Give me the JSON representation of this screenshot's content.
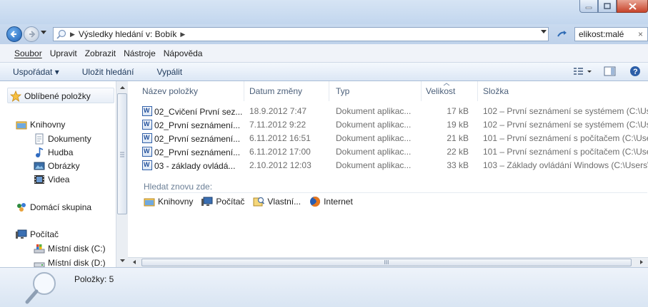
{
  "address": {
    "crumb_root": "Výsledky hledání v: Bobík"
  },
  "search": {
    "value": "elikost:malé",
    "clear": "×"
  },
  "menu": [
    "Soubor",
    "Upravit",
    "Zobrazit",
    "Nástroje",
    "Nápověda"
  ],
  "toolbar": {
    "organize": "Uspořádat ▾",
    "save_search": "Uložit hledání",
    "burn": "Vypálit"
  },
  "nav": {
    "favorites": "Oblíbené položky",
    "libraries": "Knihovny",
    "documents": "Dokumenty",
    "music": "Hudba",
    "pictures": "Obrázky",
    "videos": "Videa",
    "homegroup": "Domácí skupina",
    "computer": "Počítač",
    "disk_c": "Místní disk (C:)",
    "disk_d": "Místní disk (D:)"
  },
  "columns": {
    "name": "Název položky",
    "date": "Datum změny",
    "type": "Typ",
    "size": "Velikost",
    "folder": "Složka"
  },
  "files": [
    {
      "name": "02_Cvičení První sez...",
      "date": "18.9.2012 7:47",
      "type": "Dokument aplikac...",
      "size": "17 kB",
      "folder": "102 – První seznámení se systémem (C:\\Use"
    },
    {
      "name": "02_První seznámení...",
      "date": "7.11.2012 9:22",
      "type": "Dokument aplikac...",
      "size": "19 kB",
      "folder": "102 – První seznámení se systémem (C:\\Use"
    },
    {
      "name": "02_První seznámení...",
      "date": "6.11.2012 16:51",
      "type": "Dokument aplikac...",
      "size": "21 kB",
      "folder": "101 – První seznámení s počítačem (C:\\Use"
    },
    {
      "name": "02_První seznámení...",
      "date": "6.11.2012 17:00",
      "type": "Dokument aplikac...",
      "size": "22 kB",
      "folder": "101 – První seznámení s počítačem (C:\\Use"
    },
    {
      "name": "03 - základy ovládá...",
      "date": "2.10.2012 12:03",
      "type": "Dokument aplikac...",
      "size": "33 kB",
      "folder": "103 – Základy ovládání Windows (C:\\Users\\"
    }
  ],
  "search_again": {
    "label": "Hledat znovu zde:",
    "libraries": "Knihovny",
    "computer": "Počítač",
    "custom": "Vlastní...",
    "internet": "Internet"
  },
  "hscroll": {
    "grip": "III"
  },
  "status": {
    "count": "Položky: 5"
  }
}
